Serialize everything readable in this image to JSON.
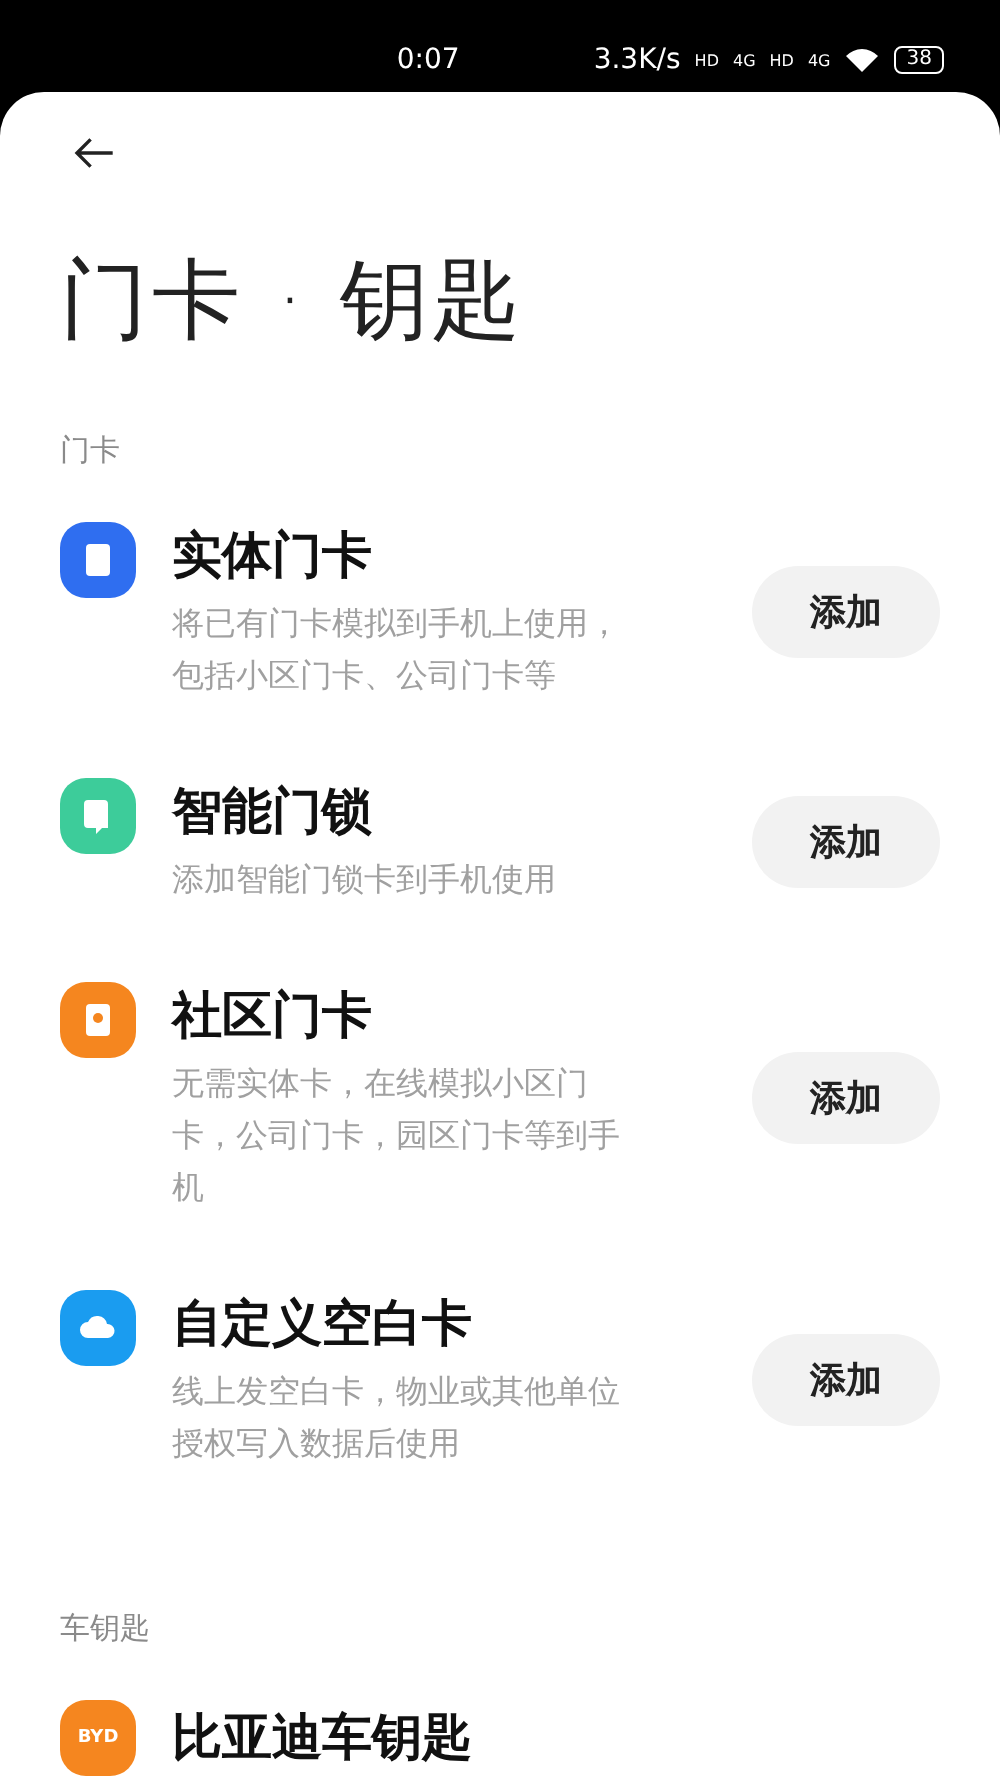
{
  "status_bar": {
    "time": "0:07",
    "speed": "3.3K/s",
    "sim_labels": [
      "HD",
      "4G",
      "HD",
      "4G"
    ],
    "battery": "38"
  },
  "title": "门卡 · 钥匙",
  "sections": [
    {
      "heading": "门卡",
      "items": [
        {
          "kind": "card",
          "color": "#2f6ef0",
          "title": "实体门卡",
          "description": "将已有门卡模拟到手机上使用，包括小区门卡、公司门卡等",
          "button": "添加"
        },
        {
          "kind": "lock",
          "color": "#3dcc9a",
          "title": "智能门锁",
          "description": "添加智能门锁卡到手机使用",
          "button": "添加"
        },
        {
          "kind": "community",
          "color": "#f5861f",
          "title": "社区门卡",
          "description": "无需实体卡，在线模拟小区门卡，公司门卡，园区门卡等到手机",
          "button": "添加"
        },
        {
          "kind": "cloud",
          "color": "#1a9cf0",
          "title": "自定义空白卡",
          "description": "线上发空白卡，物业或其他单位授权写入数据后使用",
          "button": "添加"
        }
      ]
    },
    {
      "heading": "车钥匙",
      "items": [
        {
          "kind": "logo",
          "color": "#f5861f",
          "logo_text": "BYD",
          "title": "比亚迪车钥匙"
        }
      ]
    }
  ]
}
